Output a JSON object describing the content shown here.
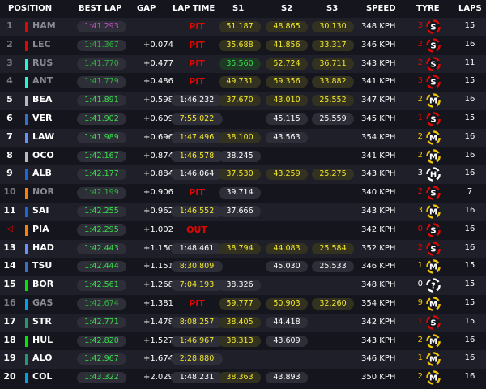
{
  "headers": {
    "position": "POSITION",
    "best_lap": "BEST LAP",
    "gap": "GAP",
    "lap_time": "LAP TIME",
    "s1": "S1",
    "s2": "S2",
    "s3": "S3",
    "speed": "SPEED",
    "tyre": "TYRE",
    "laps": "LAPS"
  },
  "colors": {
    "background": "#15151e",
    "row_alt": "#1f1f29",
    "pit_red": "#e10600",
    "personal_best_green": "#36e04a",
    "overall_best_purple": "#c64ec8",
    "yellow": "#f2e92c",
    "soft_tyre": "#e10600",
    "medium_tyre": "#f2c500",
    "hard_tyre": "#ffffff",
    "unknown_tyre": "#ffffff"
  },
  "rows": [
    {
      "pos": "1",
      "driver": "HAM",
      "team_color": "#e10600",
      "status": "out",
      "best": "1:41.293",
      "best_type": "purple",
      "gap": "",
      "lap": "PIT",
      "lap_type": "pit",
      "s1": "51.187",
      "s1c": "y",
      "s2": "48.865",
      "s2c": "y",
      "s3": "30.130",
      "s3c": "y",
      "speed": "348 KPH",
      "tyre_laps": "3",
      "tyre": "S",
      "tyre_icon": "soft-tyre-icon",
      "laps": "15"
    },
    {
      "pos": "2",
      "driver": "LEC",
      "team_color": "#e10600",
      "status": "out",
      "best": "1:41.367",
      "best_type": "green",
      "gap": "+0.074",
      "lap": "PIT",
      "lap_type": "pit",
      "s1": "35.688",
      "s1c": "y",
      "s2": "41.856",
      "s2c": "y",
      "s3": "33.317",
      "s3c": "y",
      "speed": "346 KPH",
      "tyre_laps": "2",
      "tyre": "S",
      "tyre_icon": "soft-tyre-icon",
      "laps": "16"
    },
    {
      "pos": "3",
      "driver": "RUS",
      "team_color": "#27f4d2",
      "status": "out",
      "best": "1:41.770",
      "best_type": "green",
      "gap": "+0.477",
      "lap": "PIT",
      "lap_type": "pit",
      "s1": "35.560",
      "s1c": "g",
      "s2": "52.724",
      "s2c": "y",
      "s3": "36.711",
      "s3c": "y",
      "speed": "343 KPH",
      "tyre_laps": "2",
      "tyre": "S",
      "tyre_icon": "soft-tyre-icon",
      "laps": "11"
    },
    {
      "pos": "4",
      "driver": "ANT",
      "team_color": "#27f4d2",
      "status": "out",
      "best": "1:41.779",
      "best_type": "green",
      "gap": "+0.486",
      "lap": "PIT",
      "lap_type": "pit",
      "s1": "49.731",
      "s1c": "y",
      "s2": "59.356",
      "s2c": "y",
      "s3": "33.882",
      "s3c": "y",
      "speed": "341 KPH",
      "tyre_laps": "3",
      "tyre": "S",
      "tyre_icon": "soft-tyre-icon",
      "laps": "15"
    },
    {
      "pos": "5",
      "driver": "BEA",
      "team_color": "#b6babd",
      "status": "on",
      "best": "1:41.891",
      "best_type": "green",
      "gap": "+0.598",
      "lap": "1:46.232",
      "lap_type": "white",
      "s1": "37.670",
      "s1c": "y",
      "s2": "43.010",
      "s2c": "y",
      "s3": "25.552",
      "s3c": "y",
      "speed": "347 KPH",
      "tyre_laps": "2",
      "tyre": "M",
      "tyre_icon": "medium-tyre-icon",
      "laps": "16"
    },
    {
      "pos": "6",
      "driver": "VER",
      "team_color": "#3671c6",
      "status": "on",
      "best": "1:41.902",
      "best_type": "green",
      "gap": "+0.609",
      "lap": "7:55.022",
      "lap_type": "yellow",
      "s1": "",
      "s1c": "",
      "s2": "45.115",
      "s2c": "w",
      "s3": "25.559",
      "s3c": "w",
      "speed": "345 KPH",
      "tyre_laps": "1",
      "tyre": "S",
      "tyre_icon": "soft-tyre-icon",
      "laps": "15"
    },
    {
      "pos": "7",
      "driver": "LAW",
      "team_color": "#6692ff",
      "status": "on",
      "best": "1:41.989",
      "best_type": "green",
      "gap": "+0.696",
      "lap": "1:47.496",
      "lap_type": "yellow",
      "s1": "38.100",
      "s1c": "y",
      "s2": "43.563",
      "s2c": "w",
      "s3": "",
      "s3c": "",
      "speed": "354 KPH",
      "tyre_laps": "2",
      "tyre": "M",
      "tyre_icon": "medium-tyre-icon",
      "laps": "16"
    },
    {
      "pos": "8",
      "driver": "OCO",
      "team_color": "#b6babd",
      "status": "on",
      "best": "1:42.167",
      "best_type": "green",
      "gap": "+0.874",
      "lap": "1:46.578",
      "lap_type": "yellow",
      "s1": "38.245",
      "s1c": "w",
      "s2": "",
      "s2c": "",
      "s3": "",
      "s3c": "",
      "speed": "341 KPH",
      "tyre_laps": "2",
      "tyre": "M",
      "tyre_icon": "medium-tyre-icon",
      "laps": "16"
    },
    {
      "pos": "9",
      "driver": "ALB",
      "team_color": "#1868db",
      "status": "on",
      "best": "1:42.177",
      "best_type": "green",
      "gap": "+0.884",
      "lap": "1:46.064",
      "lap_type": "white",
      "s1": "37.530",
      "s1c": "y",
      "s2": "43.259",
      "s2c": "y",
      "s3": "25.275",
      "s3c": "y",
      "speed": "343 KPH",
      "tyre_laps": "3",
      "tyre": "H",
      "tyre_icon": "hard-tyre-icon",
      "laps": "16"
    },
    {
      "pos": "10",
      "driver": "NOR",
      "team_color": "#ff8000",
      "status": "out",
      "best": "1:42.199",
      "best_type": "green",
      "gap": "+0.906",
      "lap": "PIT",
      "lap_type": "pit",
      "s1": "39.714",
      "s1c": "w",
      "s2": "",
      "s2c": "",
      "s3": "",
      "s3c": "",
      "speed": "340 KPH",
      "tyre_laps": "2",
      "tyre": "S",
      "tyre_icon": "soft-tyre-icon",
      "laps": "7"
    },
    {
      "pos": "11",
      "driver": "SAI",
      "team_color": "#1868db",
      "status": "on",
      "best": "1:42.255",
      "best_type": "green",
      "gap": "+0.962",
      "lap": "1:46.552",
      "lap_type": "yellow",
      "s1": "37.666",
      "s1c": "w",
      "s2": "",
      "s2c": "",
      "s3": "",
      "s3c": "",
      "speed": "343 KPH",
      "tyre_laps": "3",
      "tyre": "M",
      "tyre_icon": "medium-tyre-icon",
      "laps": "16"
    },
    {
      "pos": "◁",
      "driver": "PIA",
      "team_color": "#ff8000",
      "status": "flag",
      "best": "1:42.295",
      "best_type": "green",
      "gap": "+1.002",
      "lap": "OUT",
      "lap_type": "pit",
      "s1": "",
      "s1c": "",
      "s2": "",
      "s2c": "",
      "s3": "",
      "s3c": "",
      "speed": "342 KPH",
      "tyre_laps": "0",
      "tyre": "S",
      "tyre_icon": "soft-tyre-icon",
      "laps": "16"
    },
    {
      "pos": "13",
      "driver": "HAD",
      "team_color": "#6692ff",
      "status": "on",
      "best": "1:42.443",
      "best_type": "green",
      "gap": "+1.150",
      "lap": "1:48.461",
      "lap_type": "white",
      "s1": "38.794",
      "s1c": "y",
      "s2": "44.083",
      "s2c": "y",
      "s3": "25.584",
      "s3c": "y",
      "speed": "352 KPH",
      "tyre_laps": "2",
      "tyre": "S",
      "tyre_icon": "soft-tyre-icon",
      "laps": "16"
    },
    {
      "pos": "14",
      "driver": "TSU",
      "team_color": "#3671c6",
      "status": "on",
      "best": "1:42.444",
      "best_type": "green",
      "gap": "+1.151",
      "lap": "8:30.809",
      "lap_type": "yellow",
      "s1": "",
      "s1c": "",
      "s2": "45.030",
      "s2c": "w",
      "s3": "25.533",
      "s3c": "w",
      "speed": "346 KPH",
      "tyre_laps": "1",
      "tyre": "M",
      "tyre_icon": "medium-tyre-icon",
      "laps": "15"
    },
    {
      "pos": "15",
      "driver": "BOR",
      "team_color": "#00e701",
      "status": "on",
      "best": "1:42.561",
      "best_type": "green",
      "gap": "+1.268",
      "lap": "7:04.193",
      "lap_type": "yellow",
      "s1": "38.326",
      "s1c": "w",
      "s2": "",
      "s2c": "",
      "s3": "",
      "s3c": "",
      "speed": "348 KPH",
      "tyre_laps": "0",
      "tyre": "?",
      "tyre_icon": "unknown-tyre-icon",
      "laps": "15"
    },
    {
      "pos": "16",
      "driver": "GAS",
      "team_color": "#00a1e8",
      "status": "out",
      "best": "1:42.674",
      "best_type": "green",
      "gap": "+1.381",
      "lap": "PIT",
      "lap_type": "pit",
      "s1": "59.777",
      "s1c": "y",
      "s2": "50.903",
      "s2c": "y",
      "s3": "32.260",
      "s3c": "y",
      "speed": "354 KPH",
      "tyre_laps": "9",
      "tyre": "M",
      "tyre_icon": "medium-tyre-icon",
      "laps": "15"
    },
    {
      "pos": "17",
      "driver": "STR",
      "team_color": "#229971",
      "status": "on",
      "best": "1:42.771",
      "best_type": "green",
      "gap": "+1.478",
      "lap": "8:08.257",
      "lap_type": "yellow",
      "s1": "38.405",
      "s1c": "y",
      "s2": "44.418",
      "s2c": "w",
      "s3": "",
      "s3c": "",
      "speed": "342 KPH",
      "tyre_laps": "1",
      "tyre": "S",
      "tyre_icon": "soft-tyre-icon",
      "laps": "15"
    },
    {
      "pos": "18",
      "driver": "HUL",
      "team_color": "#00e701",
      "status": "on",
      "best": "1:42.820",
      "best_type": "green",
      "gap": "+1.527",
      "lap": "1:46.967",
      "lap_type": "yellow",
      "s1": "38.313",
      "s1c": "y",
      "s2": "43.609",
      "s2c": "w",
      "s3": "",
      "s3c": "",
      "speed": "343 KPH",
      "tyre_laps": "2",
      "tyre": "M",
      "tyre_icon": "medium-tyre-icon",
      "laps": "16"
    },
    {
      "pos": "19",
      "driver": "ALO",
      "team_color": "#229971",
      "status": "on",
      "best": "1:42.967",
      "best_type": "green",
      "gap": "+1.674",
      "lap": "2:28.880",
      "lap_type": "yellow",
      "s1": "",
      "s1c": "",
      "s2": "",
      "s2c": "",
      "s3": "",
      "s3c": "",
      "speed": "346 KPH",
      "tyre_laps": "1",
      "tyre": "M",
      "tyre_icon": "medium-tyre-icon",
      "laps": "16"
    },
    {
      "pos": "20",
      "driver": "COL",
      "team_color": "#00a1e8",
      "status": "on",
      "best": "1:43.322",
      "best_type": "green",
      "gap": "+2.029",
      "lap": "1:48.231",
      "lap_type": "white",
      "s1": "38.363",
      "s1c": "y",
      "s2": "43.893",
      "s2c": "w",
      "s3": "",
      "s3c": "",
      "speed": "350 KPH",
      "tyre_laps": "2",
      "tyre": "M",
      "tyre_icon": "medium-tyre-icon",
      "laps": "16"
    }
  ]
}
